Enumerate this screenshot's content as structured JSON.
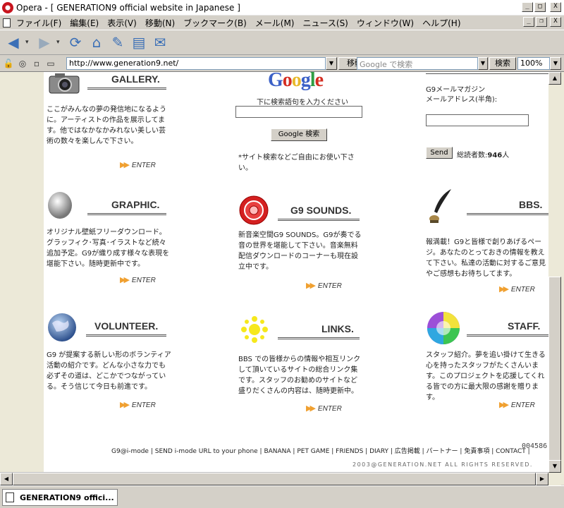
{
  "window": {
    "title": "Opera - [ GENERATION9 official website in Japanese ]",
    "btn_minimize": "_",
    "btn_maximize": "□",
    "btn_close": "X",
    "btn_restore": "❐"
  },
  "menu": [
    "ファイル(F)",
    "編集(E)",
    "表示(V)",
    "移動(N)",
    "ブックマーク(B)",
    "メール(M)",
    "ニュース(S)",
    "ウィンドウ(W)",
    "ヘルプ(H)"
  ],
  "toolbar": {
    "back_icon": "back-arrow-icon",
    "forward_icon": "forward-arrow-icon",
    "reload_icon": "reload-icon",
    "home_icon": "home-icon",
    "hotlist_icon": "hotlist-icon",
    "print_icon": "print-icon",
    "mail_icon": "mail-icon"
  },
  "address": {
    "url": "http://www.generation9.net/",
    "go_label": "移動",
    "search_placeholder": "Google で検索",
    "search_label": "検索",
    "zoom": "100%"
  },
  "page": {
    "gallery": {
      "heading": "GALLERY.",
      "desc": "ここがみんなの夢の発信地になるように。アーティストの作品を展示してます。他ではなかなかみれない美しい芸術の数々を楽しんで下さい。",
      "enter": "ENTER"
    },
    "google": {
      "logo_1": "G",
      "logo_2": "o",
      "logo_3": "o",
      "logo_4": "g",
      "logo_5": "l",
      "logo_6": "e",
      "label": "下に検索語句を入力ください",
      "button": "Google 検索",
      "note": "*サイト検索などご自由にお使い下さい。"
    },
    "magazine": {
      "label1": "G9メールマガジン",
      "label2": "メールアドレス(半角):",
      "send": "Send",
      "subscribers_prefix": "総読者数:",
      "subscribers": "946",
      "subscribers_suffix": "人"
    },
    "graphic": {
      "heading": "GRAPHIC.",
      "desc": "オリジナル壁紙フリーダウンロード。グラッフィク･写真･イラストなど続々追加予定。G9が織り成す様々な表現を堪能下さい。随時更新中です。",
      "enter": "ENTER"
    },
    "sounds": {
      "heading": "G9 SOUNDS.",
      "desc": "新音楽空間G9 SOUNDS。G9が奏でる音の世界を堪能して下さい。音楽無料配信ダウンロードのコーナーも現在設立中です。",
      "enter": "ENTER"
    },
    "bbs": {
      "heading": "BBS.",
      "desc": "報満載！G9と皆様で創りあげるページ。あなたのとっておきの情報を教えて下さい。私達の活動に対するご意見やご感想もお待ちしてます。",
      "enter": "ENTER"
    },
    "volunteer": {
      "heading": "VOLUNTEER.",
      "desc": "G9 が提案する新しい形のボランティア活動の紹介です。どんな小さな力でも必ずその道は、どこかでつながっている。そう信じて今日も前進です。",
      "enter": "ENTER"
    },
    "links": {
      "heading": "LINKS.",
      "desc": "BBS での皆様からの情報や相互リンクして頂いているサイトの総合リンク集です。スタッフのお勧めのサイトなど盛りだくさんの内容は、随時更新中。",
      "enter": "ENTER"
    },
    "staff": {
      "heading": "STAFF.",
      "desc": "スタッフ紹介。夢を追い掛けて生きる心を持ったスタッフがたくさんいます。このプロジェクトを応援してくれる皆での方に最大限の感謝を贈ります。",
      "enter": "ENTER"
    },
    "footer_links": [
      "G9@i-mode",
      "SEND i-mode URL to your phone",
      "BANANA",
      "PET GAME",
      "FRIENDS",
      "DIARY",
      "広告掲載",
      "パートナー",
      "免責事項",
      "CONTACT"
    ],
    "counter": "004586",
    "copyright": "2003@GENERATION.NET ALL RIGHTS RESERVED."
  },
  "tab": {
    "label": "GENERATION9 offici..."
  }
}
